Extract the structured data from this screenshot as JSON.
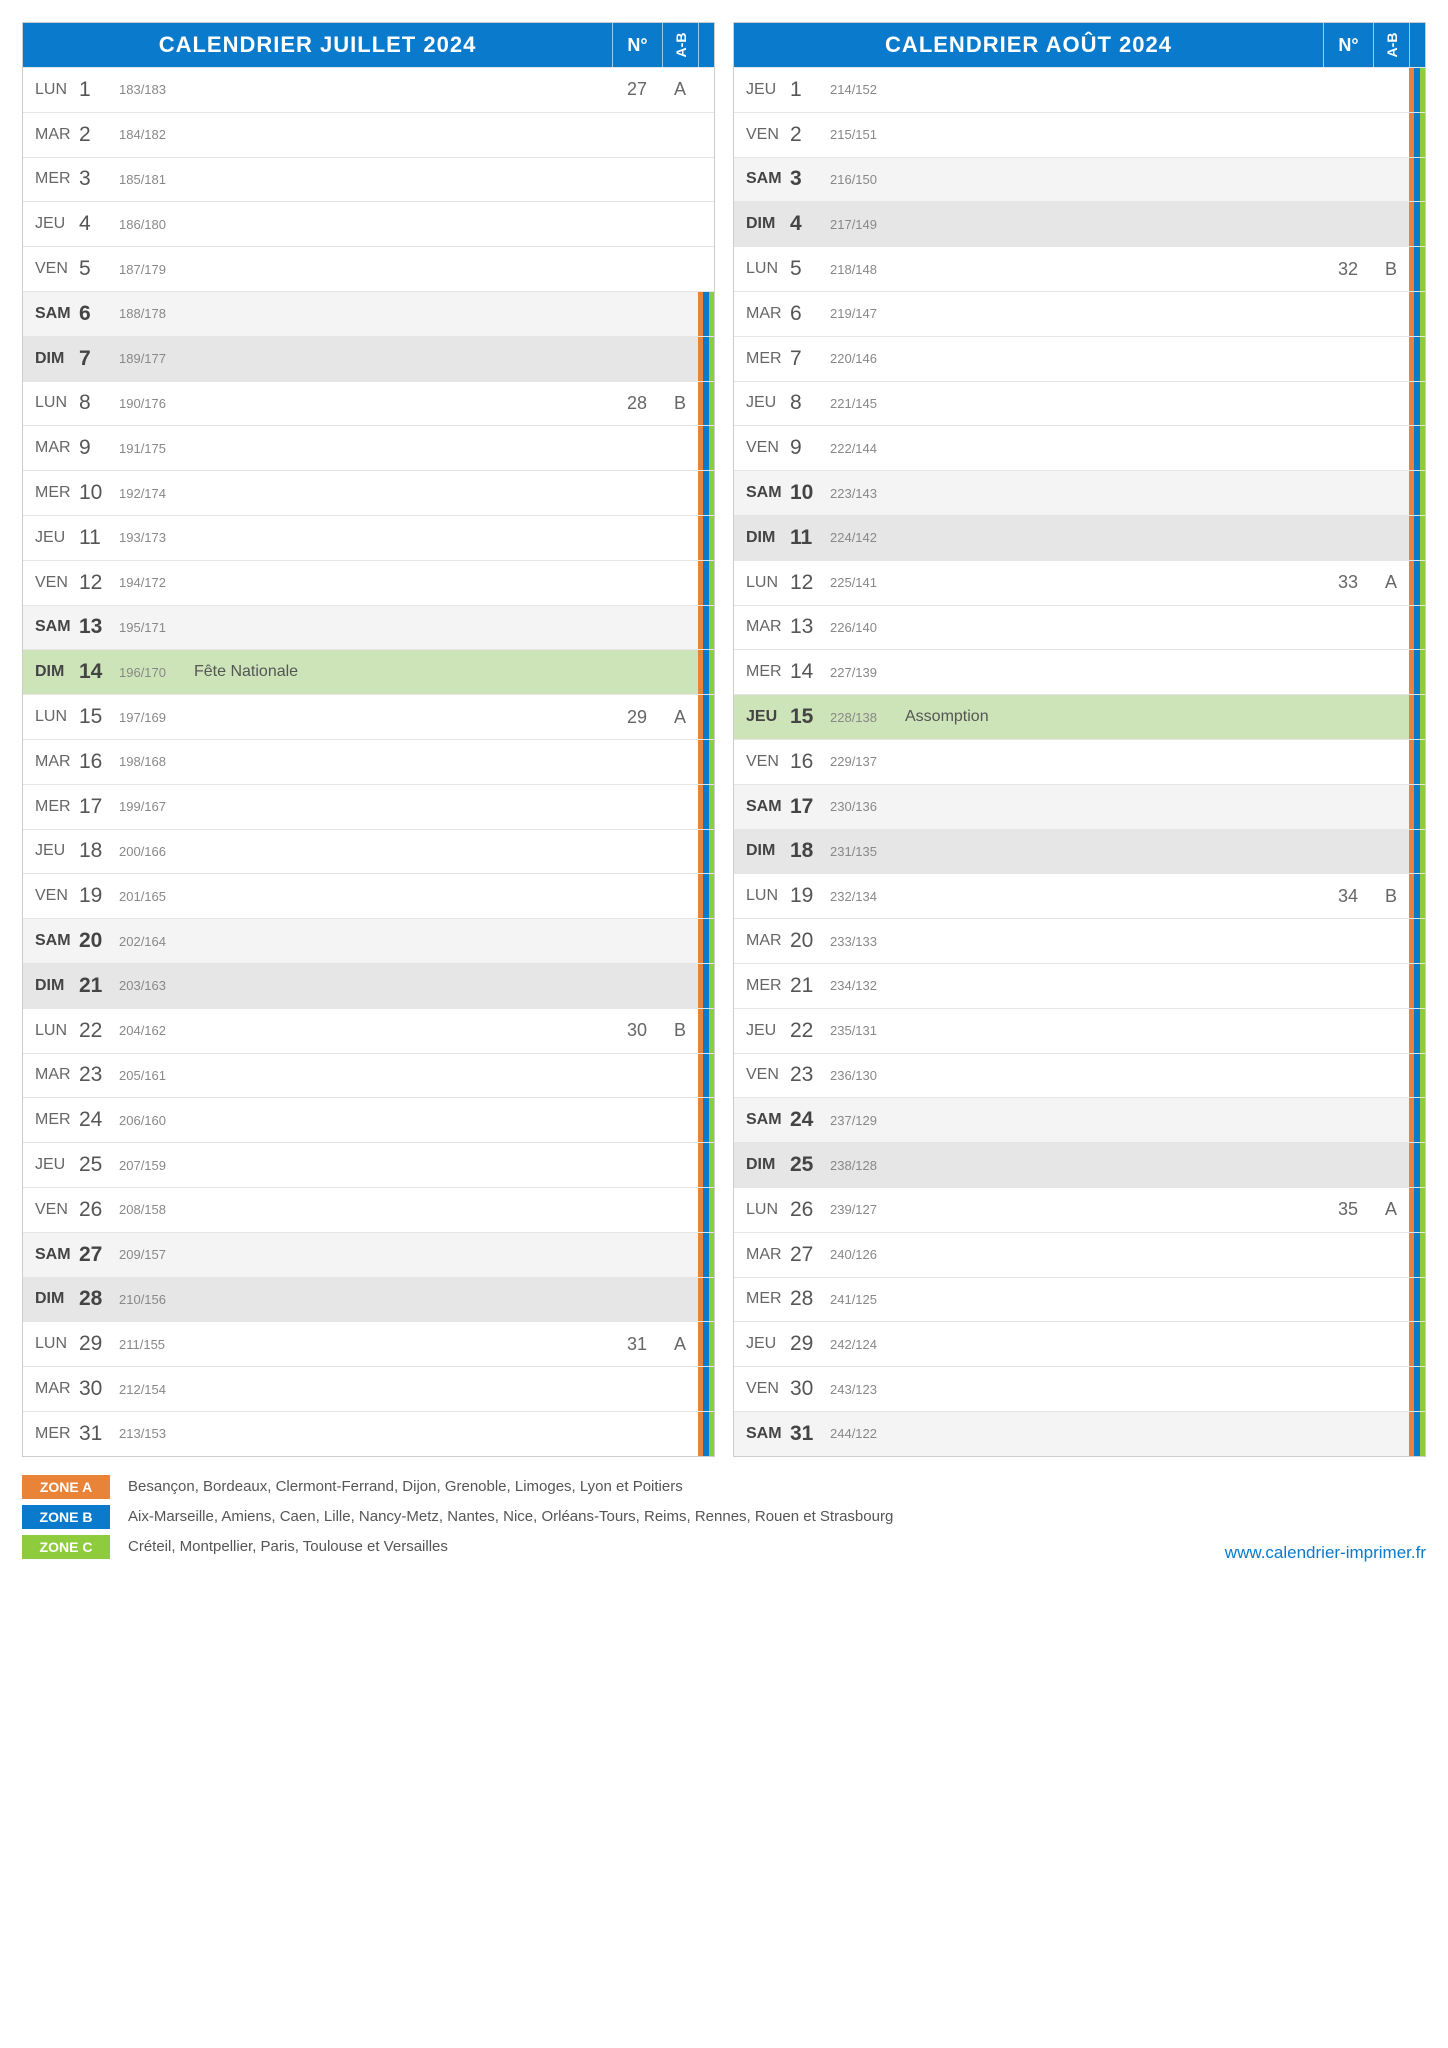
{
  "headers": {
    "num": "N°",
    "ab": "A-B"
  },
  "months": [
    {
      "title": "CALENDRIER JUILLET 2024",
      "days": [
        {
          "dow": "LUN",
          "n": "1",
          "ord": "183/183",
          "ev": "",
          "wk": "27",
          "ab": "A",
          "z": ""
        },
        {
          "dow": "MAR",
          "n": "2",
          "ord": "184/182",
          "ev": "",
          "wk": "",
          "ab": "",
          "z": ""
        },
        {
          "dow": "MER",
          "n": "3",
          "ord": "185/181",
          "ev": "",
          "wk": "",
          "ab": "",
          "z": ""
        },
        {
          "dow": "JEU",
          "n": "4",
          "ord": "186/180",
          "ev": "",
          "wk": "",
          "ab": "",
          "z": ""
        },
        {
          "dow": "VEN",
          "n": "5",
          "ord": "187/179",
          "ev": "",
          "wk": "",
          "ab": "",
          "z": ""
        },
        {
          "dow": "SAM",
          "n": "6",
          "ord": "188/178",
          "ev": "",
          "wk": "",
          "ab": "",
          "z": "ABC",
          "cls": "sat"
        },
        {
          "dow": "DIM",
          "n": "7",
          "ord": "189/177",
          "ev": "",
          "wk": "",
          "ab": "",
          "z": "ABC",
          "cls": "sun"
        },
        {
          "dow": "LUN",
          "n": "8",
          "ord": "190/176",
          "ev": "",
          "wk": "28",
          "ab": "B",
          "z": "ABC"
        },
        {
          "dow": "MAR",
          "n": "9",
          "ord": "191/175",
          "ev": "",
          "wk": "",
          "ab": "",
          "z": "ABC"
        },
        {
          "dow": "MER",
          "n": "10",
          "ord": "192/174",
          "ev": "",
          "wk": "",
          "ab": "",
          "z": "ABC"
        },
        {
          "dow": "JEU",
          "n": "11",
          "ord": "193/173",
          "ev": "",
          "wk": "",
          "ab": "",
          "z": "ABC"
        },
        {
          "dow": "VEN",
          "n": "12",
          "ord": "194/172",
          "ev": "",
          "wk": "",
          "ab": "",
          "z": "ABC"
        },
        {
          "dow": "SAM",
          "n": "13",
          "ord": "195/171",
          "ev": "",
          "wk": "",
          "ab": "",
          "z": "ABC",
          "cls": "sat"
        },
        {
          "dow": "DIM",
          "n": "14",
          "ord": "196/170",
          "ev": "Fête Nationale",
          "wk": "",
          "ab": "",
          "z": "ABC",
          "cls": "hol"
        },
        {
          "dow": "LUN",
          "n": "15",
          "ord": "197/169",
          "ev": "",
          "wk": "29",
          "ab": "A",
          "z": "ABC"
        },
        {
          "dow": "MAR",
          "n": "16",
          "ord": "198/168",
          "ev": "",
          "wk": "",
          "ab": "",
          "z": "ABC"
        },
        {
          "dow": "MER",
          "n": "17",
          "ord": "199/167",
          "ev": "",
          "wk": "",
          "ab": "",
          "z": "ABC"
        },
        {
          "dow": "JEU",
          "n": "18",
          "ord": "200/166",
          "ev": "",
          "wk": "",
          "ab": "",
          "z": "ABC"
        },
        {
          "dow": "VEN",
          "n": "19",
          "ord": "201/165",
          "ev": "",
          "wk": "",
          "ab": "",
          "z": "ABC"
        },
        {
          "dow": "SAM",
          "n": "20",
          "ord": "202/164",
          "ev": "",
          "wk": "",
          "ab": "",
          "z": "ABC",
          "cls": "sat"
        },
        {
          "dow": "DIM",
          "n": "21",
          "ord": "203/163",
          "ev": "",
          "wk": "",
          "ab": "",
          "z": "ABC",
          "cls": "sun"
        },
        {
          "dow": "LUN",
          "n": "22",
          "ord": "204/162",
          "ev": "",
          "wk": "30",
          "ab": "B",
          "z": "ABC"
        },
        {
          "dow": "MAR",
          "n": "23",
          "ord": "205/161",
          "ev": "",
          "wk": "",
          "ab": "",
          "z": "ABC"
        },
        {
          "dow": "MER",
          "n": "24",
          "ord": "206/160",
          "ev": "",
          "wk": "",
          "ab": "",
          "z": "ABC"
        },
        {
          "dow": "JEU",
          "n": "25",
          "ord": "207/159",
          "ev": "",
          "wk": "",
          "ab": "",
          "z": "ABC"
        },
        {
          "dow": "VEN",
          "n": "26",
          "ord": "208/158",
          "ev": "",
          "wk": "",
          "ab": "",
          "z": "ABC"
        },
        {
          "dow": "SAM",
          "n": "27",
          "ord": "209/157",
          "ev": "",
          "wk": "",
          "ab": "",
          "z": "ABC",
          "cls": "sat"
        },
        {
          "dow": "DIM",
          "n": "28",
          "ord": "210/156",
          "ev": "",
          "wk": "",
          "ab": "",
          "z": "ABC",
          "cls": "sun"
        },
        {
          "dow": "LUN",
          "n": "29",
          "ord": "211/155",
          "ev": "",
          "wk": "31",
          "ab": "A",
          "z": "ABC"
        },
        {
          "dow": "MAR",
          "n": "30",
          "ord": "212/154",
          "ev": "",
          "wk": "",
          "ab": "",
          "z": "ABC"
        },
        {
          "dow": "MER",
          "n": "31",
          "ord": "213/153",
          "ev": "",
          "wk": "",
          "ab": "",
          "z": "ABC"
        }
      ]
    },
    {
      "title": "CALENDRIER AOÛT 2024",
      "days": [
        {
          "dow": "JEU",
          "n": "1",
          "ord": "214/152",
          "ev": "",
          "wk": "",
          "ab": "",
          "z": "ABC"
        },
        {
          "dow": "VEN",
          "n": "2",
          "ord": "215/151",
          "ev": "",
          "wk": "",
          "ab": "",
          "z": "ABC"
        },
        {
          "dow": "SAM",
          "n": "3",
          "ord": "216/150",
          "ev": "",
          "wk": "",
          "ab": "",
          "z": "ABC",
          "cls": "sat"
        },
        {
          "dow": "DIM",
          "n": "4",
          "ord": "217/149",
          "ev": "",
          "wk": "",
          "ab": "",
          "z": "ABC",
          "cls": "sun"
        },
        {
          "dow": "LUN",
          "n": "5",
          "ord": "218/148",
          "ev": "",
          "wk": "32",
          "ab": "B",
          "z": "ABC"
        },
        {
          "dow": "MAR",
          "n": "6",
          "ord": "219/147",
          "ev": "",
          "wk": "",
          "ab": "",
          "z": "ABC"
        },
        {
          "dow": "MER",
          "n": "7",
          "ord": "220/146",
          "ev": "",
          "wk": "",
          "ab": "",
          "z": "ABC"
        },
        {
          "dow": "JEU",
          "n": "8",
          "ord": "221/145",
          "ev": "",
          "wk": "",
          "ab": "",
          "z": "ABC"
        },
        {
          "dow": "VEN",
          "n": "9",
          "ord": "222/144",
          "ev": "",
          "wk": "",
          "ab": "",
          "z": "ABC"
        },
        {
          "dow": "SAM",
          "n": "10",
          "ord": "223/143",
          "ev": "",
          "wk": "",
          "ab": "",
          "z": "ABC",
          "cls": "sat"
        },
        {
          "dow": "DIM",
          "n": "11",
          "ord": "224/142",
          "ev": "",
          "wk": "",
          "ab": "",
          "z": "ABC",
          "cls": "sun"
        },
        {
          "dow": "LUN",
          "n": "12",
          "ord": "225/141",
          "ev": "",
          "wk": "33",
          "ab": "A",
          "z": "ABC"
        },
        {
          "dow": "MAR",
          "n": "13",
          "ord": "226/140",
          "ev": "",
          "wk": "",
          "ab": "",
          "z": "ABC"
        },
        {
          "dow": "MER",
          "n": "14",
          "ord": "227/139",
          "ev": "",
          "wk": "",
          "ab": "",
          "z": "ABC"
        },
        {
          "dow": "JEU",
          "n": "15",
          "ord": "228/138",
          "ev": "Assomption",
          "wk": "",
          "ab": "",
          "z": "ABC",
          "cls": "hol"
        },
        {
          "dow": "VEN",
          "n": "16",
          "ord": "229/137",
          "ev": "",
          "wk": "",
          "ab": "",
          "z": "ABC"
        },
        {
          "dow": "SAM",
          "n": "17",
          "ord": "230/136",
          "ev": "",
          "wk": "",
          "ab": "",
          "z": "ABC",
          "cls": "sat"
        },
        {
          "dow": "DIM",
          "n": "18",
          "ord": "231/135",
          "ev": "",
          "wk": "",
          "ab": "",
          "z": "ABC",
          "cls": "sun"
        },
        {
          "dow": "LUN",
          "n": "19",
          "ord": "232/134",
          "ev": "",
          "wk": "34",
          "ab": "B",
          "z": "ABC"
        },
        {
          "dow": "MAR",
          "n": "20",
          "ord": "233/133",
          "ev": "",
          "wk": "",
          "ab": "",
          "z": "ABC"
        },
        {
          "dow": "MER",
          "n": "21",
          "ord": "234/132",
          "ev": "",
          "wk": "",
          "ab": "",
          "z": "ABC"
        },
        {
          "dow": "JEU",
          "n": "22",
          "ord": "235/131",
          "ev": "",
          "wk": "",
          "ab": "",
          "z": "ABC"
        },
        {
          "dow": "VEN",
          "n": "23",
          "ord": "236/130",
          "ev": "",
          "wk": "",
          "ab": "",
          "z": "ABC"
        },
        {
          "dow": "SAM",
          "n": "24",
          "ord": "237/129",
          "ev": "",
          "wk": "",
          "ab": "",
          "z": "ABC",
          "cls": "sat"
        },
        {
          "dow": "DIM",
          "n": "25",
          "ord": "238/128",
          "ev": "",
          "wk": "",
          "ab": "",
          "z": "ABC",
          "cls": "sun"
        },
        {
          "dow": "LUN",
          "n": "26",
          "ord": "239/127",
          "ev": "",
          "wk": "35",
          "ab": "A",
          "z": "ABC"
        },
        {
          "dow": "MAR",
          "n": "27",
          "ord": "240/126",
          "ev": "",
          "wk": "",
          "ab": "",
          "z": "ABC"
        },
        {
          "dow": "MER",
          "n": "28",
          "ord": "241/125",
          "ev": "",
          "wk": "",
          "ab": "",
          "z": "ABC"
        },
        {
          "dow": "JEU",
          "n": "29",
          "ord": "242/124",
          "ev": "",
          "wk": "",
          "ab": "",
          "z": "ABC"
        },
        {
          "dow": "VEN",
          "n": "30",
          "ord": "243/123",
          "ev": "",
          "wk": "",
          "ab": "",
          "z": "ABC"
        },
        {
          "dow": "SAM",
          "n": "31",
          "ord": "244/122",
          "ev": "",
          "wk": "",
          "ab": "",
          "z": "ABC",
          "cls": "sat"
        }
      ]
    }
  ],
  "zones": [
    {
      "label": "ZONE A",
      "color": "#e98338",
      "text": "Besançon, Bordeaux, Clermont-Ferrand, Dijon, Grenoble, Limoges, Lyon et Poitiers"
    },
    {
      "label": "ZONE B",
      "color": "#0a7acc",
      "text": "Aix-Marseille, Amiens, Caen, Lille, Nancy-Metz, Nantes, Nice, Orléans-Tours, Reims, Rennes, Rouen et Strasbourg"
    },
    {
      "label": "ZONE C",
      "color": "#8fcc3d",
      "text": "Créteil, Montpellier, Paris, Toulouse et Versailles"
    }
  ],
  "footer_link": "www.calendrier-imprimer.fr"
}
